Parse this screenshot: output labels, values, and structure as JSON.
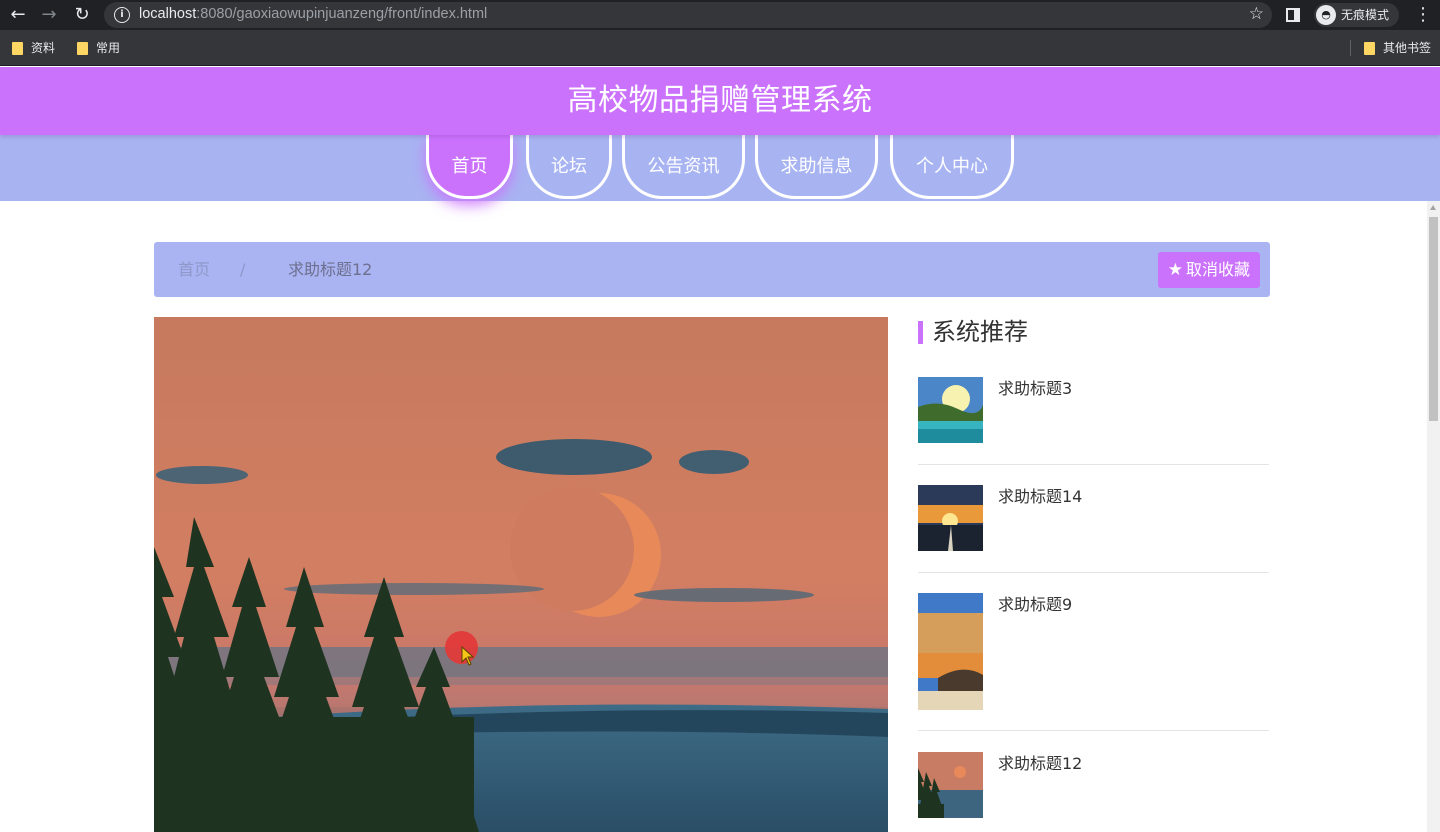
{
  "browser": {
    "url_host": "localhost",
    "url_rest": ":8080/gaoxiaowupinjuanzeng/front/index.html",
    "incognito_label": "无痕模式",
    "bookmarks": [
      "资料",
      "常用"
    ],
    "other_bookmarks": "其他书签"
  },
  "site": {
    "title": "高校物品捐赠管理系统",
    "accent": "#cb72fd",
    "nav_color": "#a8b4f2"
  },
  "nav": {
    "items": [
      {
        "label": "首页",
        "active": true
      },
      {
        "label": "论坛",
        "active": false
      },
      {
        "label": "公告资讯",
        "active": false
      },
      {
        "label": "求助信息",
        "active": false
      },
      {
        "label": "个人中心",
        "active": false
      }
    ]
  },
  "breadcrumb": {
    "home": "首页",
    "separator": "/",
    "current": "求助标题12"
  },
  "favorite_button": {
    "icon": "star-icon",
    "label": "取消收藏"
  },
  "sidebar": {
    "title": "系统推荐",
    "items": [
      {
        "title": "求助标题3",
        "thumb": "lake-sunrise"
      },
      {
        "title": "求助标题14",
        "thumb": "road-sunset"
      },
      {
        "title": "求助标题9",
        "thumb": "beach-dusk"
      },
      {
        "title": "求助标题12",
        "thumb": "moon-forest"
      }
    ]
  }
}
